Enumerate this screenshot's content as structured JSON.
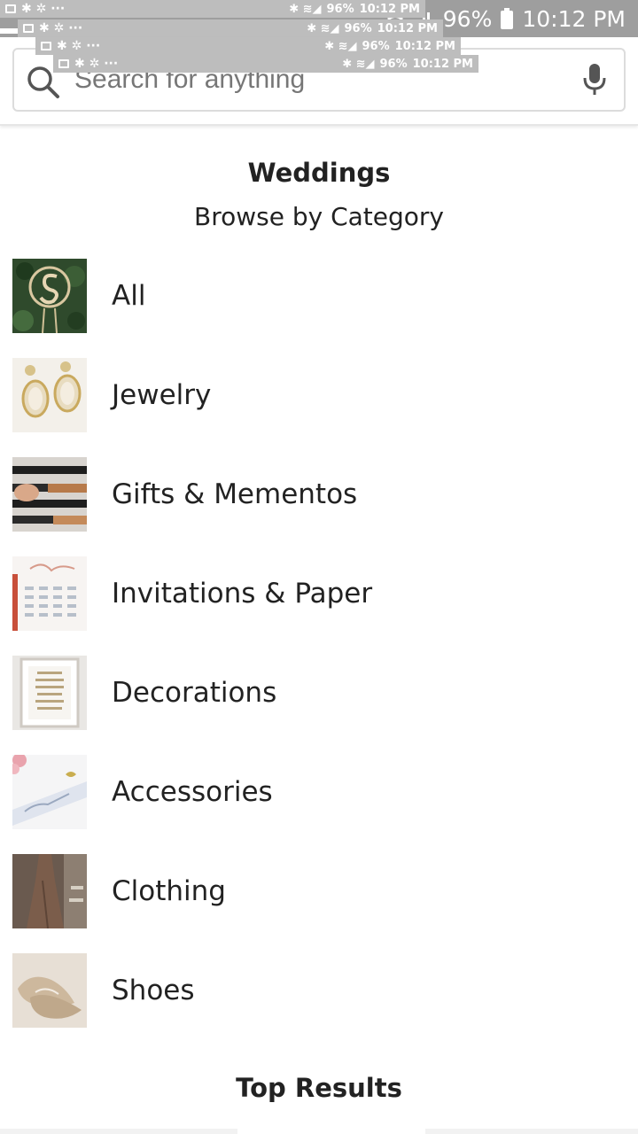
{
  "status_bar": {
    "battery": "96%",
    "time": "10:12 PM"
  },
  "ghost_notifications": [
    {
      "battery": "96%",
      "time": "10:12 PM"
    },
    {
      "battery": "96%",
      "time": "10:12 PM"
    },
    {
      "battery": "96%",
      "time": "10:12 PM"
    },
    {
      "battery": "96%",
      "time": "10:12 PM"
    }
  ],
  "search": {
    "placeholder": "Search for anything",
    "icon": "search-icon",
    "voice_icon": "mic-icon"
  },
  "page": {
    "title": "Weddings",
    "subtitle": "Browse by Category"
  },
  "categories": [
    {
      "label": "All"
    },
    {
      "label": "Jewelry"
    },
    {
      "label": "Gifts & Mementos"
    },
    {
      "label": "Invitations & Paper"
    },
    {
      "label": "Decorations"
    },
    {
      "label": "Accessories"
    },
    {
      "label": "Clothing"
    },
    {
      "label": "Shoes"
    }
  ],
  "top_results": {
    "title": "Top Results"
  }
}
